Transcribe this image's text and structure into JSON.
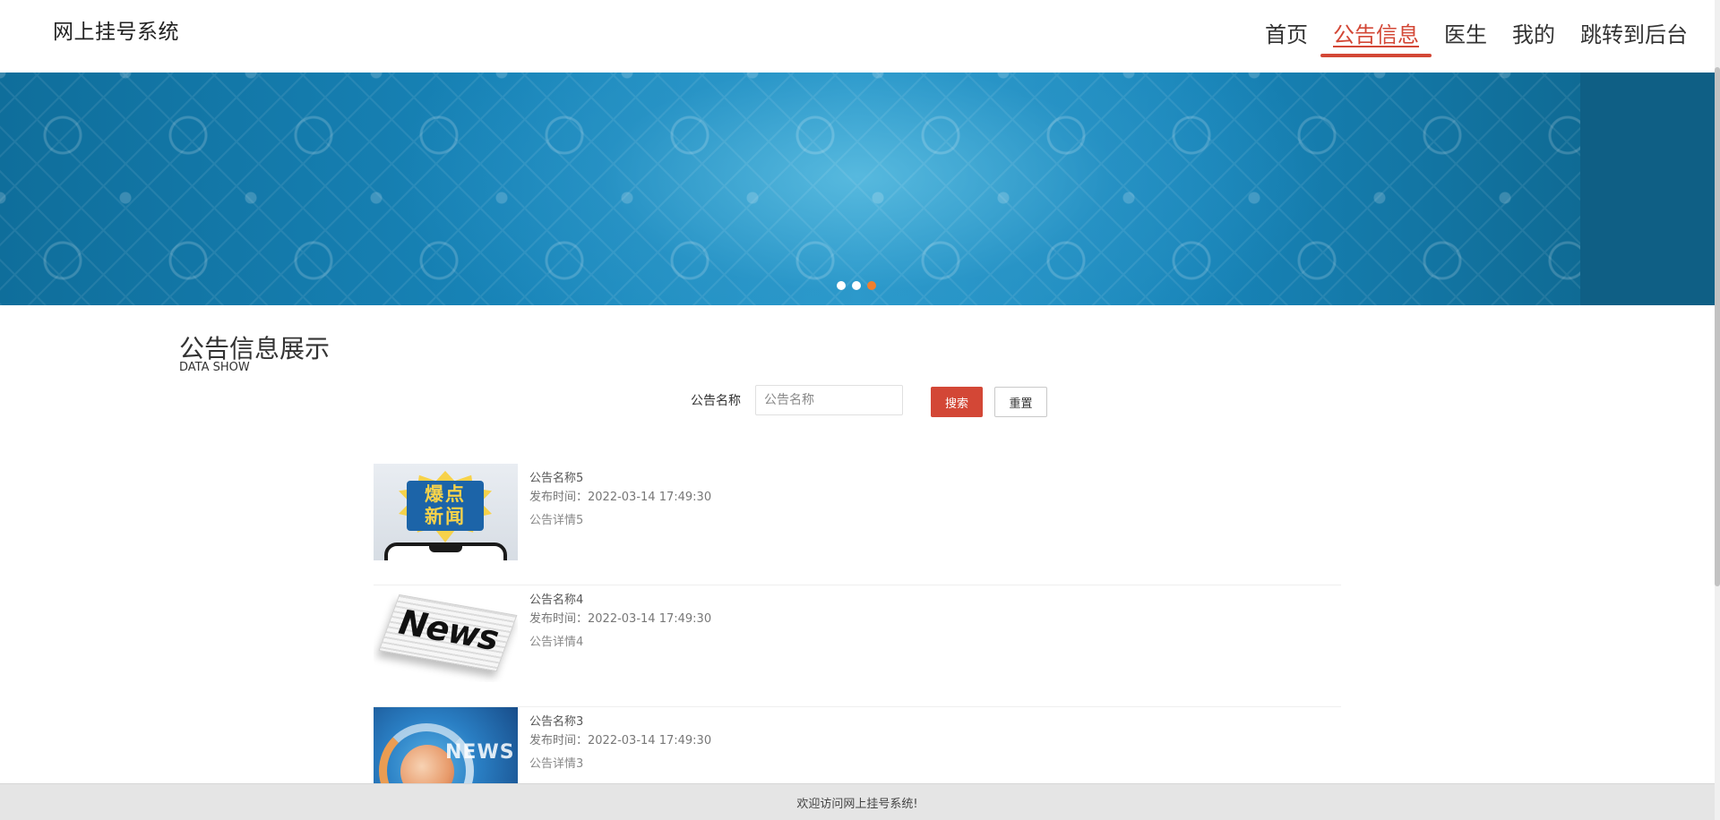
{
  "header": {
    "brand": "网上挂号系统",
    "nav": [
      {
        "label": "首页",
        "active": false
      },
      {
        "label": "公告信息",
        "active": true
      },
      {
        "label": "医生",
        "active": false
      },
      {
        "label": "我的",
        "active": false
      },
      {
        "label": "跳转到后台",
        "active": false
      }
    ]
  },
  "banner": {
    "active_slide": 3,
    "slide_count": 3
  },
  "section": {
    "title": "公告信息展示",
    "subtitle": "DATA SHOW"
  },
  "search": {
    "label": "公告名称",
    "placeholder": "公告名称",
    "value": "",
    "search_button": "搜索",
    "reset_button": "重置"
  },
  "notices": [
    {
      "name": "公告名称5",
      "time_label": "发布时间：",
      "time": "2022-03-14 17:49:30",
      "detail": "公告详情5",
      "thumb_text": "爆点新闻"
    },
    {
      "name": "公告名称4",
      "time_label": "发布时间：",
      "time": "2022-03-14 17:49:30",
      "detail": "公告详情4",
      "thumb_text": "News"
    },
    {
      "name": "公告名称3",
      "time_label": "发布时间：",
      "time": "2022-03-14 17:49:30",
      "detail": "公告详情3",
      "thumb_text": "NEWS"
    }
  ],
  "footer": {
    "text": "欢迎访问网上挂号系统!"
  },
  "colors": {
    "accent": "#d34736",
    "dot_active": "#f07f2e",
    "banner": "#1884b8",
    "footer_bg": "#e5e5e5"
  }
}
